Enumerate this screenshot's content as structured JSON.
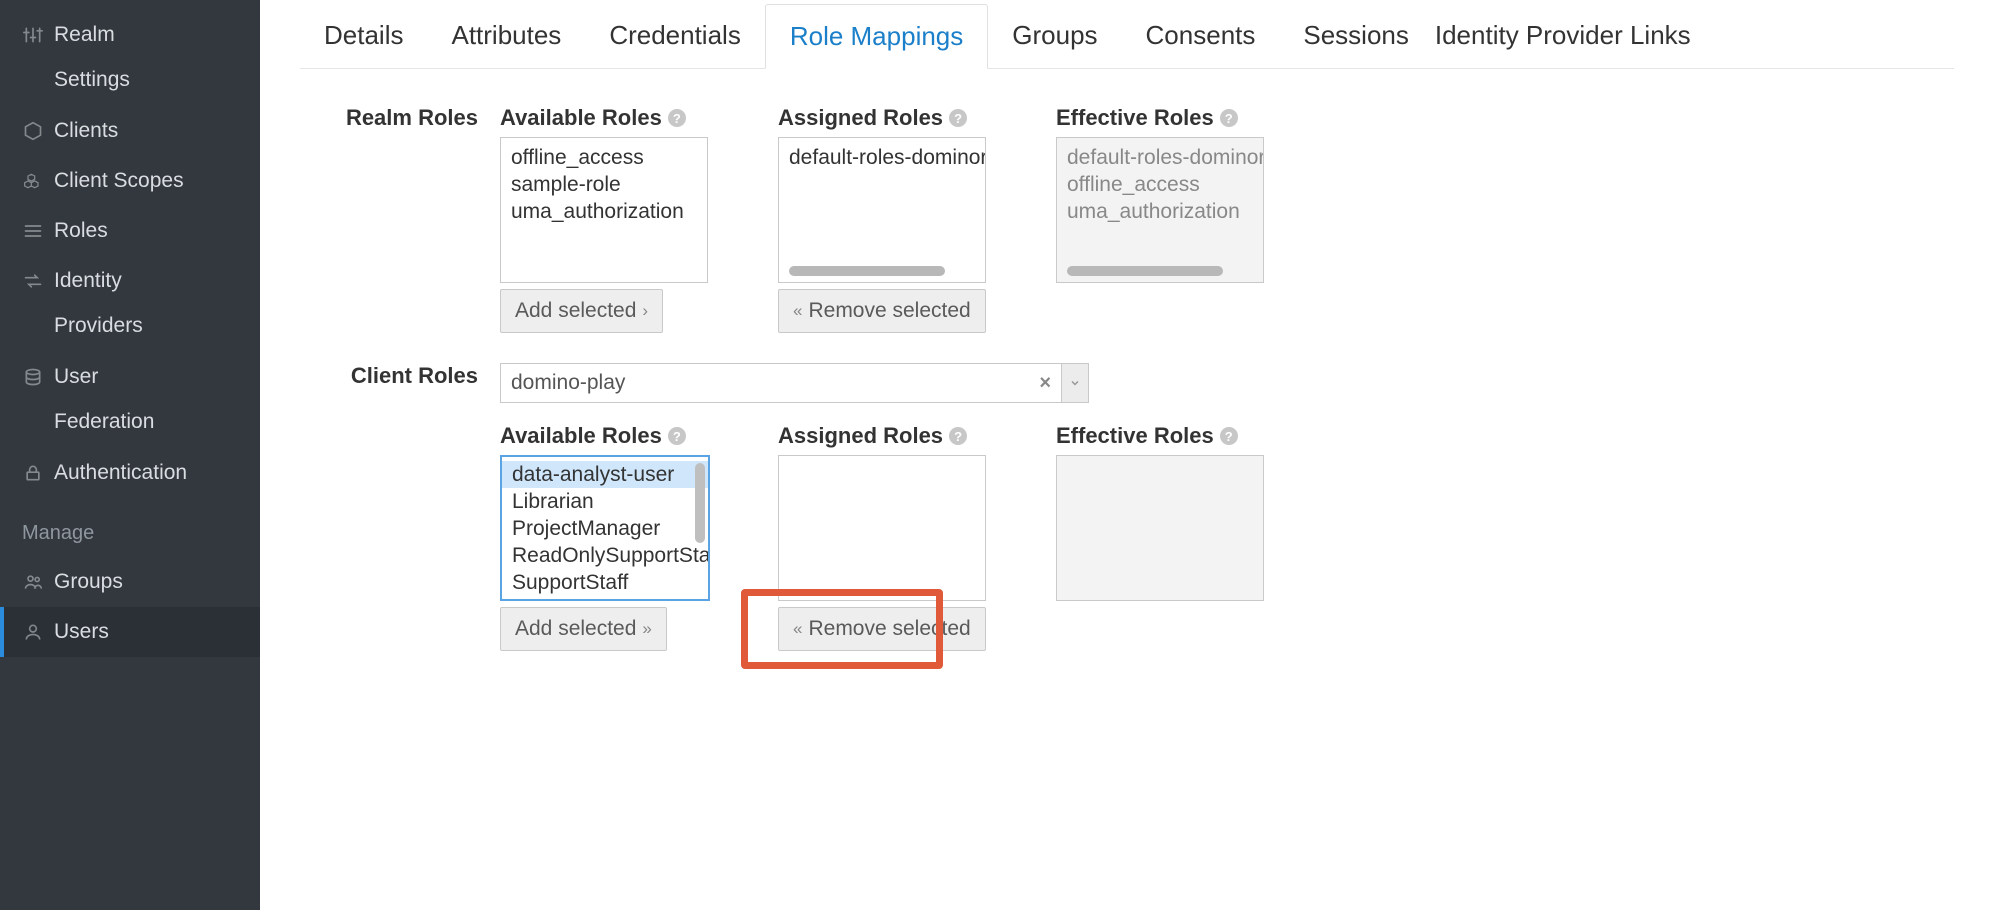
{
  "sidebar": {
    "items": [
      {
        "label": "Realm",
        "icon": "sliders-icon"
      },
      {
        "sub": "Settings"
      },
      {
        "label": "Clients",
        "icon": "cube-icon"
      },
      {
        "label": "Client Scopes",
        "icon": "cubes-icon"
      },
      {
        "label": "Roles",
        "icon": "list-icon"
      },
      {
        "label": "Identity",
        "icon": "exchange-icon"
      },
      {
        "sub": "Providers"
      },
      {
        "label": "User",
        "icon": "database-icon"
      },
      {
        "sub": "Federation"
      },
      {
        "label": "Authentication",
        "icon": "lock-icon"
      }
    ],
    "section": "Manage",
    "manage": [
      {
        "label": "Groups",
        "icon": "group-icon"
      },
      {
        "label": "Users",
        "icon": "user-icon",
        "active": true
      }
    ]
  },
  "tabs": [
    "Details",
    "Attributes",
    "Credentials",
    "Role Mappings",
    "Groups",
    "Consents",
    "Sessions",
    "Identity Provider Links"
  ],
  "active_tab": "Role Mappings",
  "realm": {
    "label": "Realm Roles",
    "available_header": "Available Roles",
    "assigned_header": "Assigned Roles",
    "effective_header": "Effective Roles",
    "available": [
      "offline_access",
      "sample-role",
      "uma_authorization"
    ],
    "assigned": [
      "default-roles-dominor"
    ],
    "effective": [
      "default-roles-dominor",
      "offline_access",
      "uma_authorization"
    ],
    "add_btn": "Add selected",
    "remove_btn": "Remove selected"
  },
  "client": {
    "label": "Client Roles",
    "selected_client": "domino-play",
    "available_header": "Available Roles",
    "assigned_header": "Assigned Roles",
    "effective_header": "Effective Roles",
    "available": [
      "data-analyst-user",
      "Librarian",
      "ProjectManager",
      "ReadOnlySupportStaff",
      "SupportStaff"
    ],
    "selected_available_index": 0,
    "assigned": [],
    "effective": [],
    "add_btn": "Add selected",
    "remove_btn": "Remove selected"
  }
}
